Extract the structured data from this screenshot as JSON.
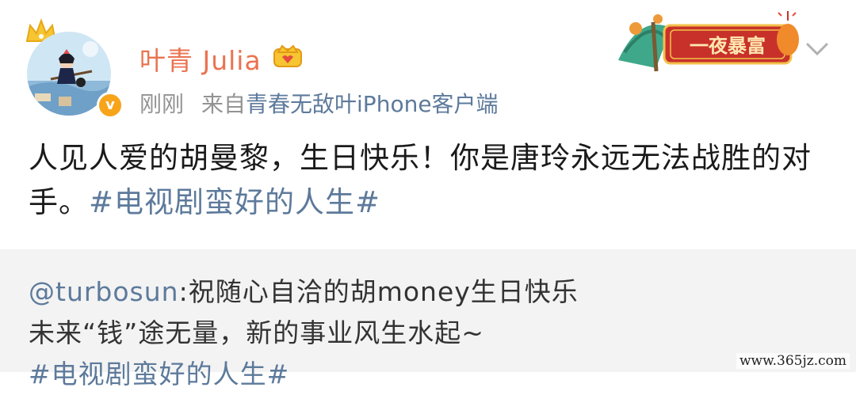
{
  "post": {
    "username": "叶青 Julia",
    "timestamp": "刚刚",
    "source_prefix": "来自",
    "source_client": "青春无敌叶iPhone客户端",
    "content_text": "人见人爱的胡曼黎，生日快乐！你是唐玲永远无法战胜的对手。",
    "content_hashtag": "#电视剧蛮好的人生#",
    "banner_text": "一夜暴富",
    "verified_symbol": "v"
  },
  "repost": {
    "mention": "@turbosun",
    "line1": ":祝随心自洽的胡money生日快乐",
    "line2": "未来“钱”途无量，新的事业风生水起~",
    "hashtag": "#电视剧蛮好的人生#"
  },
  "watermark": "www.365jz.com",
  "colors": {
    "username": "#eb7350",
    "link": "#5d7a9b",
    "meta": "#939393",
    "repost_bg": "#f3f3f3",
    "verified": "#f7a41b",
    "banner_red": "#c8312a"
  }
}
